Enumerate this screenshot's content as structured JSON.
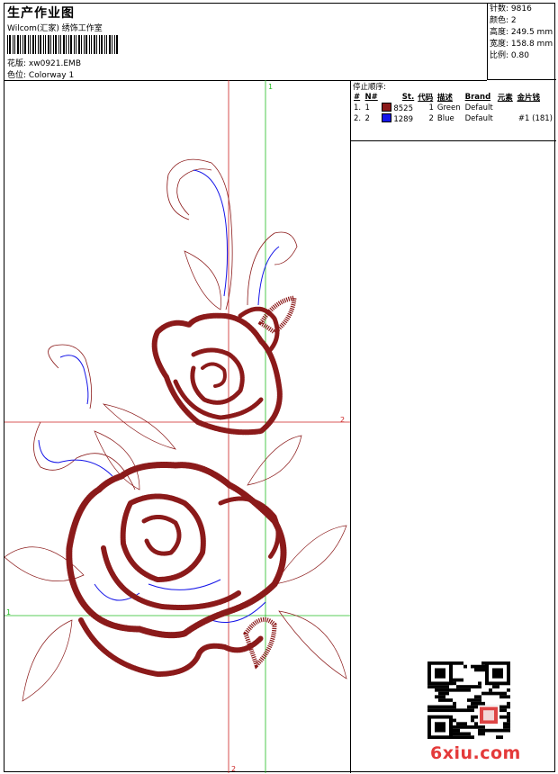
{
  "header": {
    "title": "生产作业图",
    "company": "Wilcom(汇家) 绣饰工作室",
    "design_label": "花版:",
    "design_value": "xw0921.EMB",
    "colorway_label": "色位:",
    "colorway_value": "Colorway 1"
  },
  "specs": [
    {
      "label": "针数:",
      "value": "9816"
    },
    {
      "label": "颜色:",
      "value": "2"
    },
    {
      "label": "高度:",
      "value": "249.5 mm"
    },
    {
      "label": "宽度:",
      "value": "158.8 mm"
    },
    {
      "label": "比例:",
      "value": "0.80"
    }
  ],
  "stop_sequence": {
    "caption": "停止顺序:",
    "columns": [
      "#",
      "N#",
      "St.",
      "代码",
      "描述",
      "Brand",
      "元素",
      "金片钱"
    ],
    "rows": [
      {
        "num": "1.",
        "n": "1",
        "code": "8525",
        "st": "1",
        "desc": "Green",
        "brand": "Default",
        "elem": "",
        "sequin": "",
        "color": "#8b1a1a"
      },
      {
        "num": "2.",
        "n": "2",
        "code": "1289",
        "st": "2",
        "desc": "Blue",
        "brand": "Default",
        "elem": "",
        "sequin": "#1 (181)",
        "color": "#1515e8"
      }
    ]
  },
  "guides": {
    "top_label": "1",
    "right_label": "2",
    "left_label": "1",
    "bottom_label": "2",
    "red_color": "#cc2222",
    "green_color": "#22bb22"
  },
  "colors": {
    "stitch_red": "#8b1a1a",
    "stitch_blue": "#1515e8"
  },
  "watermark": {
    "logo_text": "6xiu.com"
  }
}
